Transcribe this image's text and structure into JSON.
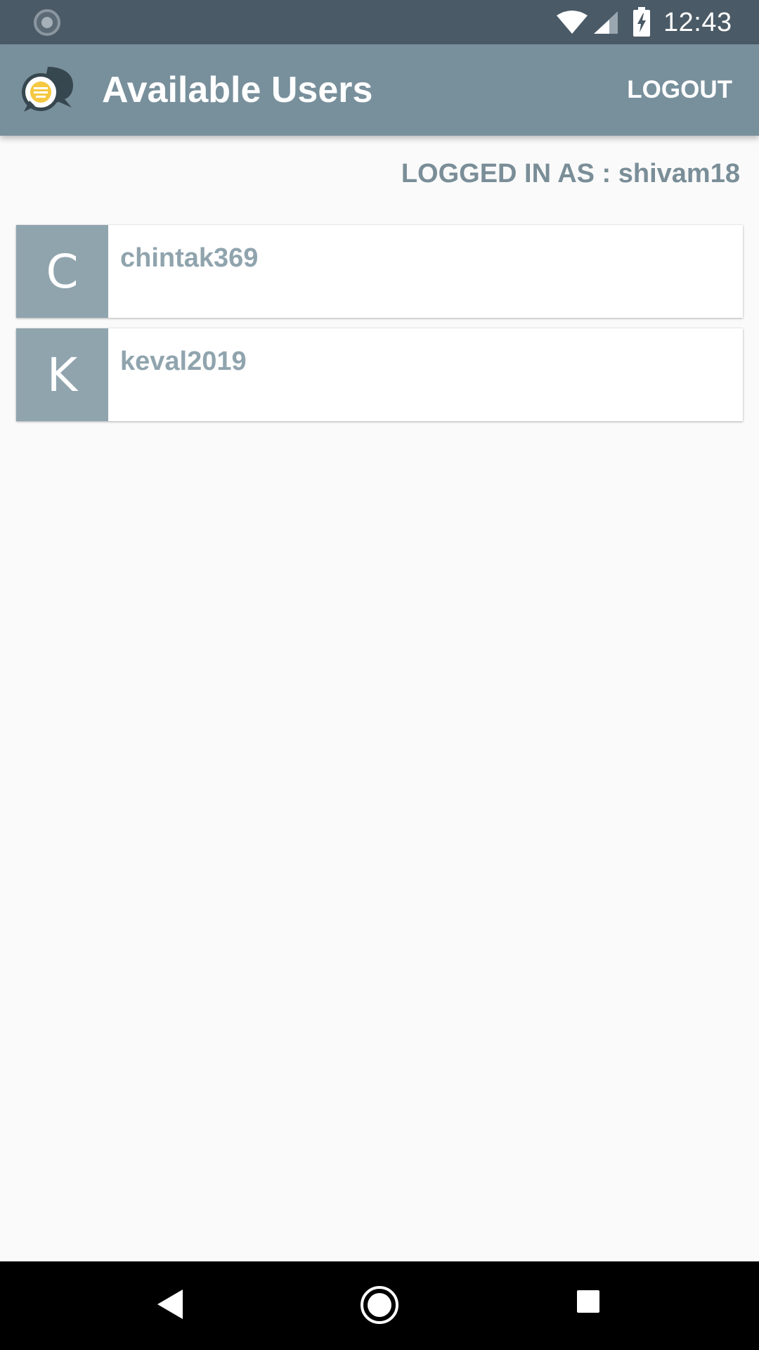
{
  "status_bar": {
    "time": "12:43",
    "icons": [
      "sync-icon",
      "wifi-icon",
      "cellular-signal-icon",
      "battery-charging-icon"
    ]
  },
  "app_bar": {
    "title": "Available Users",
    "logout_label": "LOGOUT",
    "logo_icon": "chat-bubbles-logo-icon"
  },
  "session": {
    "logged_in_text": "LOGGED IN AS : shivam18"
  },
  "users": [
    {
      "initial": "C",
      "username": "chintak369"
    },
    {
      "initial": "K",
      "username": "keval2019"
    }
  ],
  "nav_bar": {
    "icons": [
      "back-icon",
      "home-icon",
      "recents-icon"
    ]
  },
  "colors": {
    "status_bar": "#4a5a66",
    "app_bar": "#78909c",
    "avatar_bg": "#90a4ae",
    "username_text": "#90a4ae",
    "logged_in_text": "#7a8e98",
    "background": "#fafafa",
    "logo_accent": "#f5c842"
  }
}
